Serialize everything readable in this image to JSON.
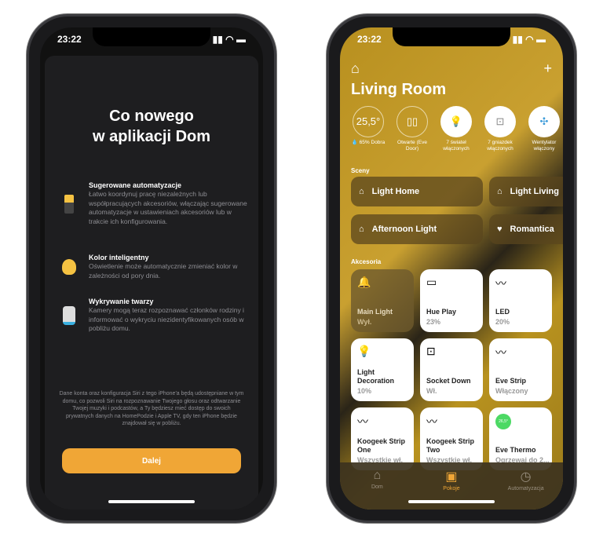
{
  "left": {
    "time": "23:22",
    "title_line1": "Co nowego",
    "title_line2": "w aplikacji Dom",
    "features": [
      {
        "icon": "automation-phone-icon",
        "title": "Sugerowane automatyzacje",
        "text": "Łatwo koordynuj pracę niezależnych lub współpracujących akcesoriów, włączając sugerowane automatyzacje w ustawieniach akcesoriów lub w trakcie ich konfigurowania."
      },
      {
        "icon": "lightbulb-icon",
        "title": "Kolor inteligentny",
        "text": "Oświetlenie może automatycznie zmieniać kolor w zależności od pory dnia."
      },
      {
        "icon": "camera-icon",
        "title": "Wykrywanie twarzy",
        "text": "Kamery mogą teraz rozpoznawać członków rodziny i informować o wykryciu niezidentyfikowanych osób w pobliżu domu."
      }
    ],
    "note": "Dane konta oraz konfiguracja Siri z tego iPhone'a będą udostępniane w tym domu, co pozwoli Siri na rozpoznawanie Twojego głosu oraz odtwarzanie Twojej muzyki i podcastów, a Ty będziesz mieć dostęp do swoich prywatnych danych na HomePodzie i Apple TV, gdy ten iPhone będzie znajdował się w pobliżu.",
    "button": "Dalej",
    "accent": "#f0a636"
  },
  "right": {
    "time": "23:22",
    "room": "Living Room",
    "stats": [
      {
        "value": "25,5°",
        "label": "💧 65% Dobra"
      },
      {
        "value": "▯▯",
        "label": "Otwarte (Eve Door)"
      },
      {
        "value": "💡",
        "label": "7 świateł włączonych"
      },
      {
        "value": "⊡",
        "label": "7 gniazdek włączonych"
      },
      {
        "value": "✣",
        "label": "Wentylator włączony"
      }
    ],
    "scenes_label": "Sceny",
    "scenes": [
      "Light Home",
      "Light Living",
      "Afternoon Light",
      "Romantica"
    ],
    "accessories_label": "Akcesoria",
    "tiles": [
      {
        "name": "Main Light",
        "status": "Wył.",
        "off": true,
        "icon": "🔔"
      },
      {
        "name": "Hue Play",
        "status": "23%",
        "icon": "▭"
      },
      {
        "name": "LED",
        "status": "20%",
        "icon": "〰"
      },
      {
        "name": "Light Decoration",
        "status": "10%",
        "icon": "💡"
      },
      {
        "name": "Socket Down",
        "status": "Wł.",
        "icon": "⊡"
      },
      {
        "name": "Eve Strip",
        "status": "Włączony",
        "icon": "〰"
      },
      {
        "name": "Koogeek Strip One",
        "status": "Wszystkie wł.",
        "icon": "〰"
      },
      {
        "name": "Koogeek Strip Two",
        "status": "Wszystkie wł.",
        "icon": "〰"
      },
      {
        "name": "Eve Thermo",
        "status": "Ogrzewaj do 2...",
        "icon": "26,5°"
      }
    ],
    "tabs": [
      {
        "label": "Dom",
        "icon": "home-icon"
      },
      {
        "label": "Pokoje",
        "icon": "rooms-icon",
        "active": true
      },
      {
        "label": "Automatyzacja",
        "icon": "automation-icon"
      }
    ]
  }
}
